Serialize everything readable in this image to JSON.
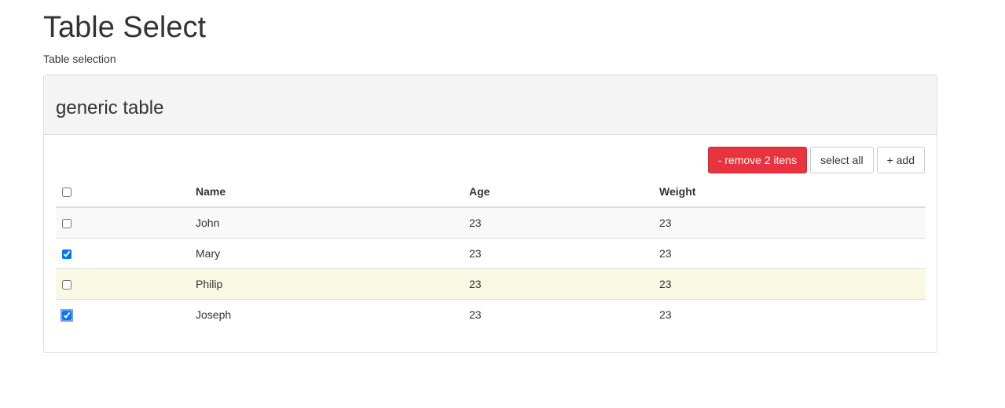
{
  "page": {
    "title": "Table Select",
    "subtitle": "Table selection"
  },
  "panel": {
    "heading": "generic table"
  },
  "toolbar": {
    "remove_label": "- remove 2 itens",
    "select_all_label": "select all",
    "add_label": "+ add"
  },
  "table": {
    "columns": [
      "Name",
      "Age",
      "Weight"
    ],
    "header_checked": false,
    "rows": [
      {
        "name": "John",
        "age": "23",
        "weight": "23",
        "checked": false
      },
      {
        "name": "Mary",
        "age": "23",
        "weight": "23",
        "checked": true
      },
      {
        "name": "Philip",
        "age": "23",
        "weight": "23",
        "checked": false
      },
      {
        "name": "Joseph",
        "age": "23",
        "weight": "23",
        "checked": true
      }
    ]
  },
  "colors": {
    "danger": "#e8343f",
    "row_hover": "#f9f9e3",
    "row_striped": "#f9f9f9"
  }
}
